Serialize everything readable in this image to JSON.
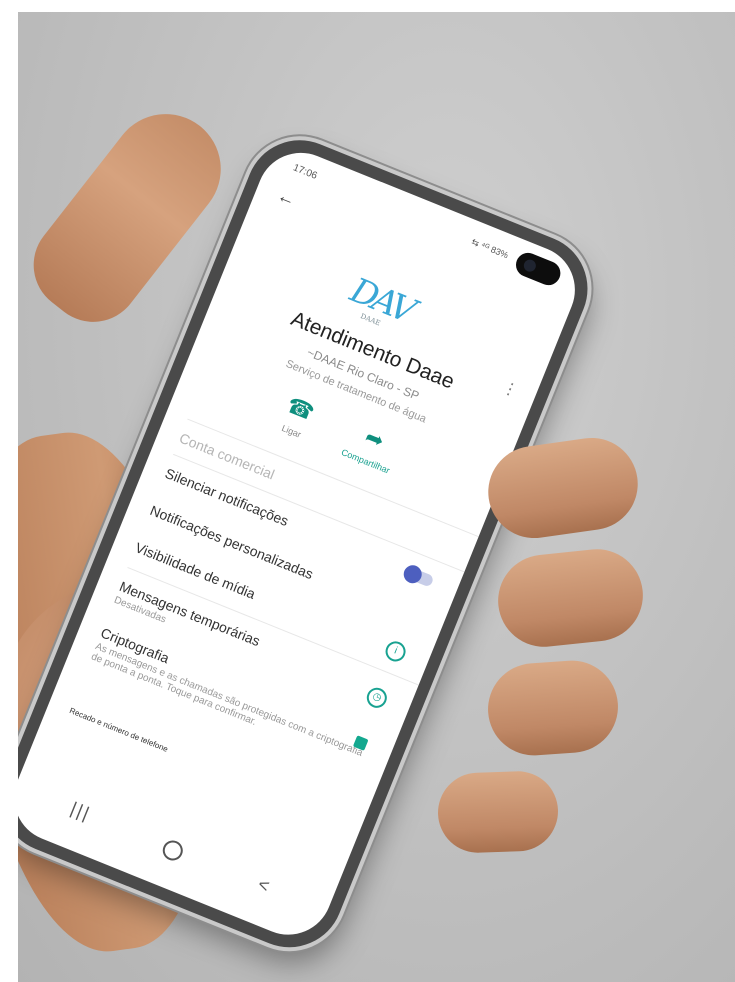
{
  "status_bar": {
    "time": "17:06",
    "icons": "⇆ ⁴ᴳ 83%"
  },
  "logo": {
    "text": "DAV",
    "tagline": "DAAE"
  },
  "contact": {
    "name": "Atendimento Daae",
    "company": "~DAAE Rio Claro - SP",
    "description": "Serviço de tratamento de água"
  },
  "actions": [
    {
      "icon": "phone-icon",
      "glyph": "☎",
      "label": "Ligar"
    },
    {
      "icon": "share-icon",
      "glyph": "➦",
      "label": "Compartilhar"
    }
  ],
  "settings": {
    "faded_top": "Conta comercial",
    "mute": "Silenciar notificações",
    "custom_notifications": "Notificações personalizadas",
    "media_visibility": "Visibilidade de mídia",
    "temporary_messages": {
      "label": "Mensagens temporárias",
      "sub": "Desativadas"
    },
    "encryption": {
      "label": "Criptografia",
      "sub": "As mensagens e as chamadas são protegidas com a criptografia de ponta a ponta. Toque para confirmar."
    },
    "bottom_note": "Recado e número de telefone"
  },
  "colors": {
    "accent": "#0f8f7e",
    "toggle": "#4d5fbf",
    "logo": "#3aa7d6"
  }
}
